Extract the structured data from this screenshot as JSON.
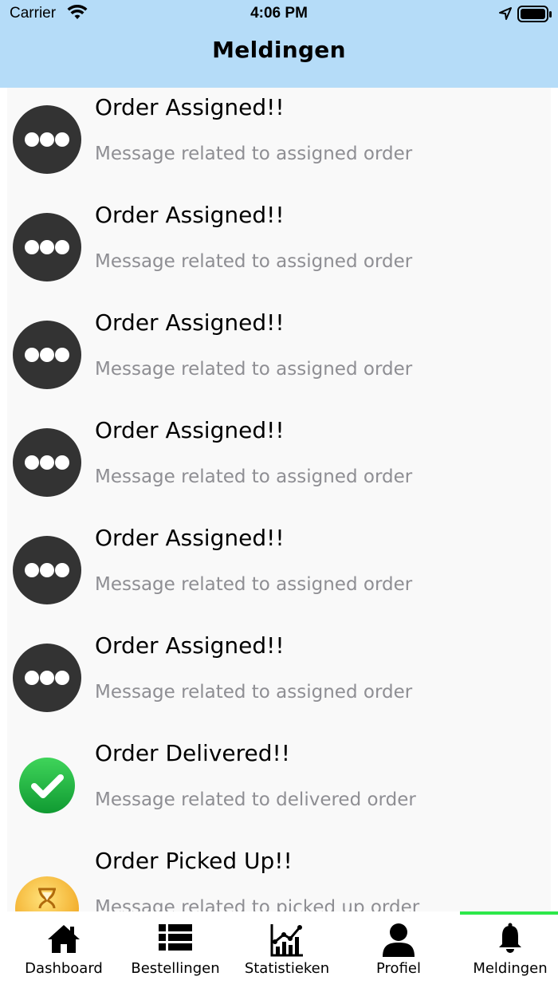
{
  "status_bar": {
    "carrier": "Carrier",
    "time": "4:06 PM"
  },
  "header": {
    "title": "Meldingen",
    "background_color": "#b5dcf8"
  },
  "notifications": [
    {
      "title": "Order Assigned!!",
      "message": "Message related to assigned order",
      "icon": "dots-icon"
    },
    {
      "title": "Order Assigned!!",
      "message": "Message related to assigned order",
      "icon": "dots-icon"
    },
    {
      "title": "Order Assigned!!",
      "message": "Message related to assigned order",
      "icon": "dots-icon"
    },
    {
      "title": "Order Assigned!!",
      "message": "Message related to assigned order",
      "icon": "dots-icon"
    },
    {
      "title": "Order Assigned!!",
      "message": "Message related to assigned order",
      "icon": "dots-icon"
    },
    {
      "title": "Order Assigned!!",
      "message": "Message related to assigned order",
      "icon": "dots-icon"
    },
    {
      "title": "Order Delivered!!",
      "message": "Message related to delivered order",
      "icon": "check-icon"
    },
    {
      "title": "Order Picked Up!!",
      "message": "Message related to picked up order",
      "icon": "hourglass-icon"
    }
  ],
  "tabbar": {
    "active_color": "#2de84a",
    "tabs": [
      {
        "label": "Dashboard",
        "icon": "home-icon"
      },
      {
        "label": "Bestellingen",
        "icon": "list-icon"
      },
      {
        "label": "Statistieken",
        "icon": "chart-icon"
      },
      {
        "label": "Profiel",
        "icon": "user-icon"
      },
      {
        "label": "Meldingen",
        "icon": "bell-icon",
        "active": true
      }
    ]
  }
}
